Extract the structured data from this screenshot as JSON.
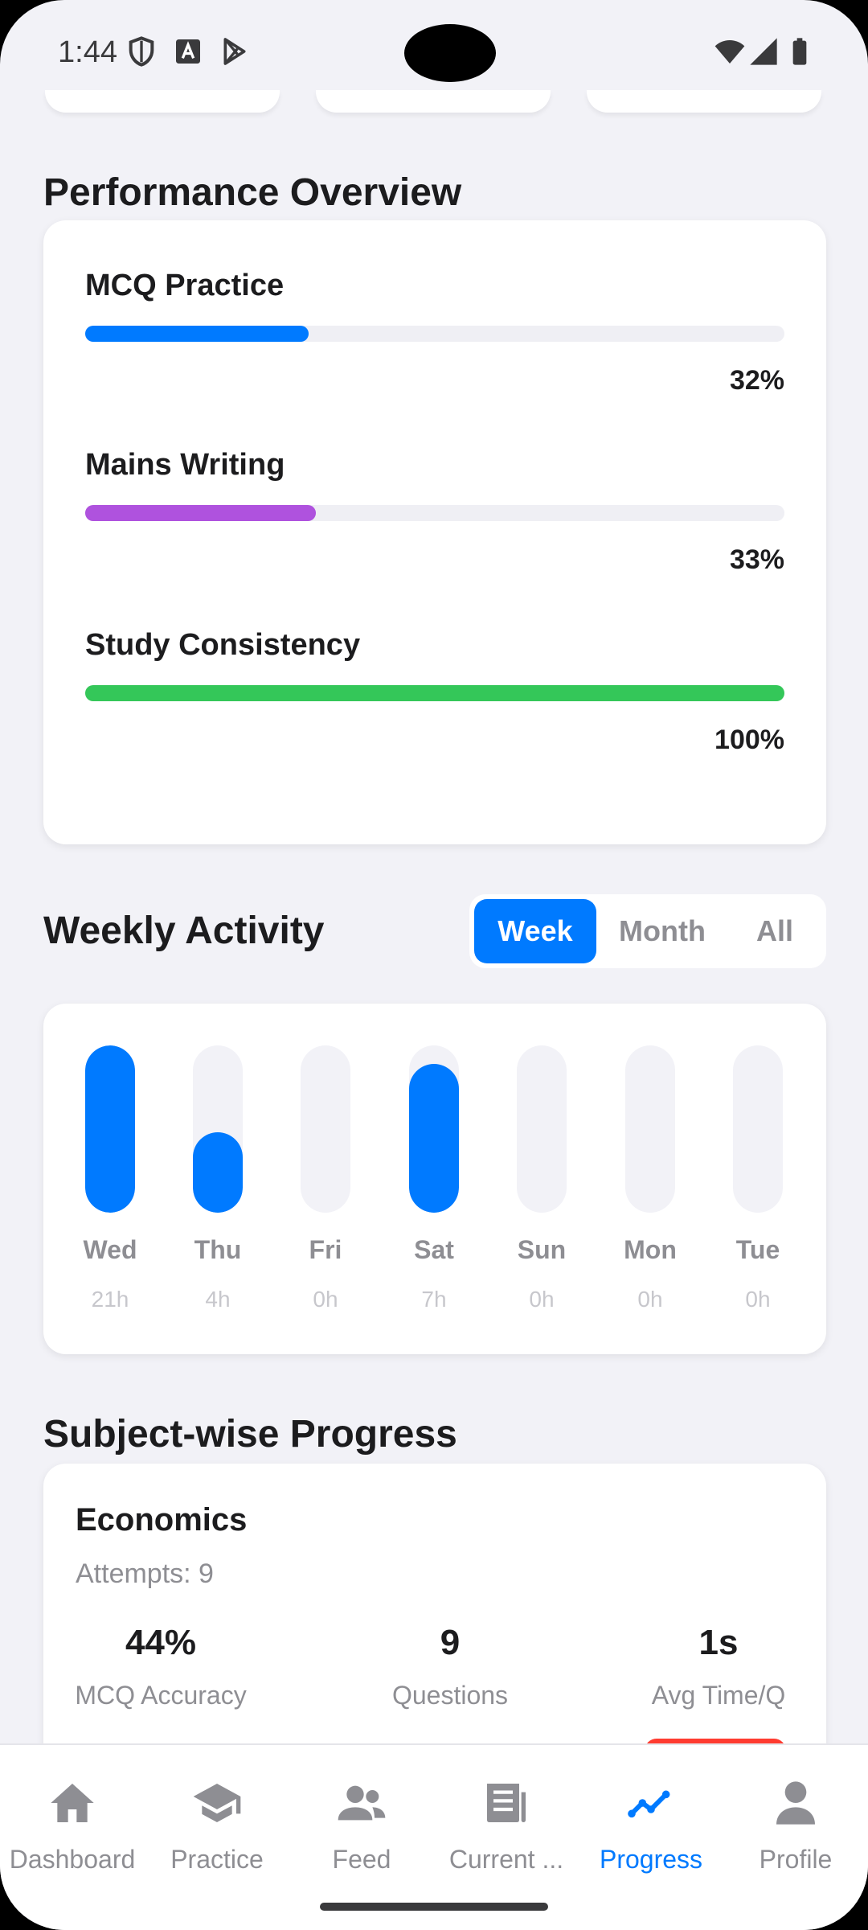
{
  "status_bar": {
    "time": "1:44",
    "icons": [
      "shield-icon",
      "font-icon",
      "play-store-icon",
      "wifi-icon",
      "signal-icon",
      "battery-icon"
    ]
  },
  "performance": {
    "title": "Performance Overview",
    "items": [
      {
        "label": "MCQ Practice",
        "percent_text": "32%",
        "fraction": 0.32,
        "color": "#007aff"
      },
      {
        "label": "Mains Writing",
        "percent_text": "33%",
        "fraction": 0.33,
        "color": "#af52de"
      },
      {
        "label": "Study Consistency",
        "percent_text": "100%",
        "fraction": 1.0,
        "color": "#34c759"
      }
    ]
  },
  "weekly": {
    "title": "Weekly Activity",
    "tabs": [
      {
        "label": "Week",
        "active": true
      },
      {
        "label": "Month",
        "active": false
      },
      {
        "label": "All",
        "active": false
      }
    ],
    "days": [
      {
        "day": "Wed",
        "hours_text": "21h",
        "level": 1.0
      },
      {
        "day": "Thu",
        "hours_text": "4h",
        "level": 0.48
      },
      {
        "day": "Fri",
        "hours_text": "0h",
        "level": 0
      },
      {
        "day": "Sat",
        "hours_text": "7h",
        "level": 0.89
      },
      {
        "day": "Sun",
        "hours_text": "0h",
        "level": 0
      },
      {
        "day": "Mon",
        "hours_text": "0h",
        "level": 0
      },
      {
        "day": "Tue",
        "hours_text": "0h",
        "level": 0
      }
    ],
    "bar_color": "#007aff"
  },
  "subjects": {
    "title": "Subject-wise Progress",
    "items": [
      {
        "name": "Economics",
        "attempts": "Attempts: 9",
        "stats": [
          {
            "value": "44%",
            "label": "MCQ Accuracy"
          },
          {
            "value": "9",
            "label": "Questions"
          },
          {
            "value": "1s",
            "label": "Avg Time/Q"
          }
        ]
      }
    ]
  },
  "nav": {
    "items": [
      {
        "label": "Dashboard",
        "icon": "home-icon",
        "active": false
      },
      {
        "label": "Practice",
        "icon": "graduation-cap-icon",
        "active": false
      },
      {
        "label": "Feed",
        "icon": "people-icon",
        "active": false
      },
      {
        "label": "Current ...",
        "icon": "newspaper-icon",
        "active": false
      },
      {
        "label": "Progress",
        "icon": "chart-line-icon",
        "active": true
      },
      {
        "label": "Profile",
        "icon": "person-icon",
        "active": false
      }
    ],
    "active_color": "#007aff",
    "inactive_color": "#8e8e93"
  }
}
